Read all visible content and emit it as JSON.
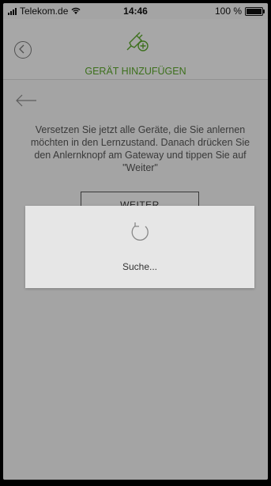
{
  "status_bar": {
    "carrier": "Telekom.de",
    "time": "14:46",
    "battery": "100 %"
  },
  "header": {
    "title": "GERÄT HINZUFÜGEN",
    "back_icon": "back-circle-icon",
    "plug_icon": "plug-add-icon"
  },
  "content": {
    "instructions": "Versetzen Sie jetzt alle Geräte, die Sie anlernen möchten in den Lernzustand. Danach drücken Sie den Anlernknopf am Gateway und tippen Sie auf \"Weiter\"",
    "continue_button": "WEITER"
  },
  "dialog": {
    "message": "Suche..."
  },
  "colors": {
    "accent": "#5aa52b",
    "overlay": "rgba(0,0,0,0.32)"
  }
}
